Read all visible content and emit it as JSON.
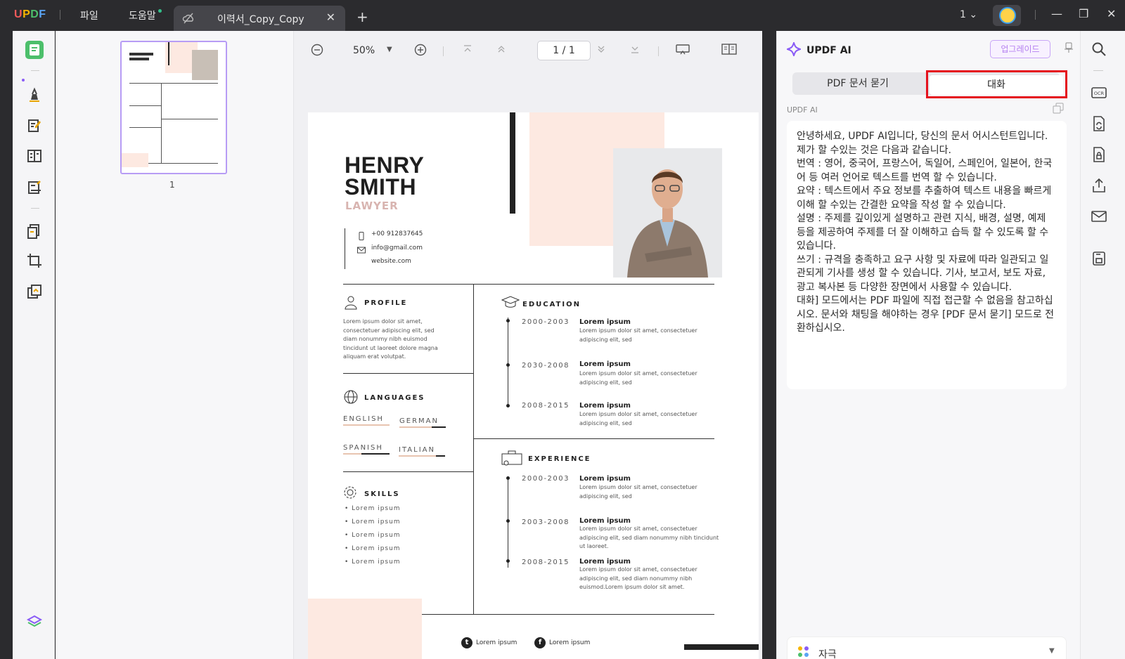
{
  "app": {
    "logo": "UPDF",
    "menu": {
      "file": "파일",
      "help": "도움말"
    },
    "tab_title": "이력서_Copy_Copy",
    "tab_close": "✕",
    "new_tab": "+",
    "page_selector": "1",
    "window": {
      "minimize": "—",
      "restore": "❐",
      "close": "✕"
    }
  },
  "thumbnails": {
    "page_label": "1"
  },
  "toolbar": {
    "zoom": "50%",
    "page_current": "1",
    "page_sep": "/",
    "page_total": "1"
  },
  "document": {
    "first_name": "HENRY",
    "last_name": "SMITH",
    "role": "LAWYER",
    "phone": "+00 912837645",
    "email": "info@gmail.com",
    "website": "website.com",
    "profile": {
      "title": "PROFILE",
      "text": "Lorem ipsum dolor sit amet, consectetuer adipiscing elit, sed diam nonummy nibh euismod tincidunt ut laoreet dolore magna aliquam erat volutpat."
    },
    "languages": {
      "title": "LANGUAGES",
      "items": [
        "ENGLISH",
        "GERMAN",
        "SPANISH",
        "ITALIAN"
      ]
    },
    "skills": {
      "title": "SKILLS",
      "items": [
        "• Lorem ipsum",
        "• Lorem ipsum",
        "• Lorem ipsum",
        "• Lorem ipsum",
        "• Lorem ipsum"
      ]
    },
    "education": {
      "title": "EDUCATION",
      "entries": [
        {
          "year": "2000-2003",
          "title": "Lorem ipsum",
          "text": "Lorem ipsum dolor sit amet, consectetuer adipiscing elit, sed"
        },
        {
          "year": "2030-2008",
          "title": "Lorem ipsum",
          "text": "Lorem ipsum dolor sit amet, consectetuer adipiscing elit, sed"
        },
        {
          "year": "2008-2015",
          "title": "Lorem ipsum",
          "text": "Lorem ipsum dolor sit amet, consectetuer adipiscing elit, sed"
        }
      ]
    },
    "experience": {
      "title": "EXPERIENCE",
      "entries": [
        {
          "year": "2000-2003",
          "title": "Lorem ipsum",
          "text": "Lorem ipsum dolor sit amet, consectetuer adipiscing elit, sed"
        },
        {
          "year": "2003-2008",
          "title": "Lorem ipsum",
          "text": "Lorem ipsum dolor sit amet, consectetuer adipiscing elit, sed diam nonummy nibh tincidunt ut laoreet."
        },
        {
          "year": "2008-2015",
          "title": "Lorem ipsum",
          "text": "Lorem ipsum dolor sit amet, consectetuer adipiscing elit, sed diam nonummy nibh euismod.Lorem ipsum dolor sit amet."
        }
      ]
    },
    "social": {
      "twitter": "Lorem ipsum",
      "facebook": "Lorem ipsum"
    }
  },
  "ai_panel": {
    "title": "UPDF AI",
    "upgrade": "업그레이드",
    "tab_ask_pdf": "PDF 문서 묻기",
    "tab_chat": "대화",
    "sender_label": "UPDF AI",
    "message": [
      "안녕하세요, UPDF AI입니다, 당신의 문서 어시스턴트입니다. 제가 할 수있는 것은 다음과 같습니다.",
      "번역 : 영어, 중국어, 프랑스어, 독일어, 스페인어, 일본어, 한국어 등 여러 언어로 텍스트를 번역 할 수 있습니다.",
      "요약 : 텍스트에서 주요 정보를 추출하여 텍스트 내용을 빠르게 이해 할 수있는 간결한 요약을 작성 할 수 있습니다.",
      "설명 : 주제를 깊이있게 설명하고 관련 지식, 배경, 설명, 예제 등을 제공하여 주제를 더 잘 이해하고 습득 할 수 있도록 할 수 있습니다.",
      "쓰기 : 규격을 충족하고 요구 사항 및 자료에 따라 일관되고 일관되게 기사를 생성 할 수 있습니다. 기사, 보고서, 보도 자료, 광고 복사본 등 다양한 장면에서 사용할 수 있습니다.",
      "대화] 모드에서는 PDF 파일에 직접 접근할 수 없음을 참고하십시오. 문서와 채팅을 해야하는 경우 [PDF 문서 묻기] 모드로 전환하십시오."
    ],
    "prompt_label": "자극"
  },
  "colors": {
    "accent": "#8a5cf6",
    "highlight": "#e5121e",
    "resume_pink": "#fde9e1",
    "role_pink": "#d8b4b0"
  }
}
